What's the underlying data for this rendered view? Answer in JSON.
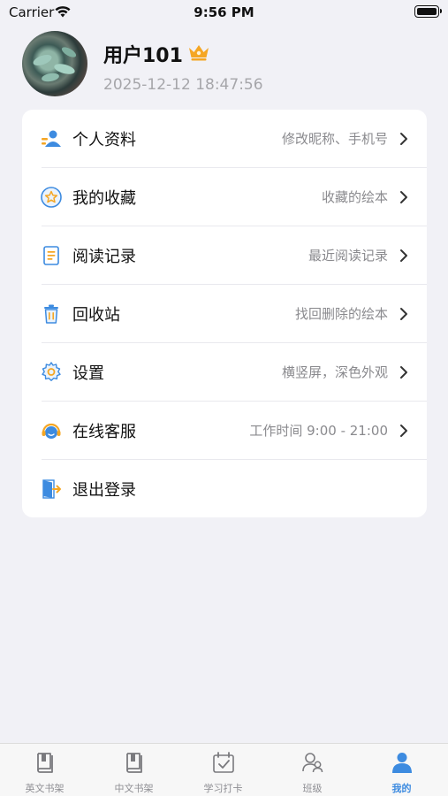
{
  "status_bar": {
    "carrier": "Carrier",
    "time": "9:56 PM"
  },
  "profile": {
    "username": "用户101",
    "badge_icon": "crown-icon",
    "join_time": "2025-12-12 18:47:56"
  },
  "menu": [
    {
      "icon": "person-card-icon",
      "label": "个人资料",
      "detail": "修改昵称、手机号",
      "has_chevron": true
    },
    {
      "icon": "star-icon",
      "label": "我的收藏",
      "detail": "收藏的绘本",
      "has_chevron": true
    },
    {
      "icon": "document-icon",
      "label": "阅读记录",
      "detail": "最近阅读记录",
      "has_chevron": true
    },
    {
      "icon": "trash-icon",
      "label": "回收站",
      "detail": "找回删除的绘本",
      "has_chevron": true
    },
    {
      "icon": "gear-icon",
      "label": "设置",
      "detail": "横竖屏，深色外观",
      "has_chevron": true
    },
    {
      "icon": "headset-icon",
      "label": "在线客服",
      "detail": "工作时间 9:00 - 21:00",
      "has_chevron": true
    },
    {
      "icon": "logout-icon",
      "label": "退出登录",
      "detail": "",
      "has_chevron": false
    }
  ],
  "tabs": [
    {
      "icon": "book-icon",
      "label": "英文书架",
      "active": false
    },
    {
      "icon": "book-icon",
      "label": "中文书架",
      "active": false
    },
    {
      "icon": "calendar-check-icon",
      "label": "学习打卡",
      "active": false
    },
    {
      "icon": "people-icon",
      "label": "班级",
      "active": false
    },
    {
      "icon": "user-icon",
      "label": "我的",
      "active": true
    }
  ],
  "colors": {
    "accent": "#3d8be0",
    "icon_orange": "#f5a623",
    "background": "#f1f1f6"
  }
}
